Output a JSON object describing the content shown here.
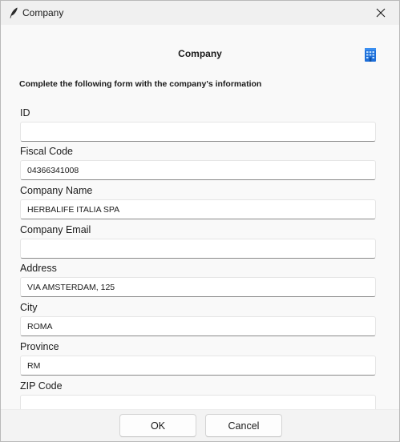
{
  "window": {
    "title": "Company",
    "icon": "feather-icon",
    "close_icon": "close-icon"
  },
  "header": {
    "title": "Company",
    "icon": "building-icon",
    "icon_color": "#1e6fd9"
  },
  "instruction": "Complete the following form with the company's information",
  "fields": [
    {
      "label": "ID",
      "value": "",
      "placeholder": ""
    },
    {
      "label": "Fiscal Code",
      "value": "04366341008",
      "placeholder": ""
    },
    {
      "label": "Company Name",
      "value": "HERBALIFE ITALIA SPA",
      "placeholder": ""
    },
    {
      "label": "Company Email",
      "value": "",
      "placeholder": ""
    },
    {
      "label": "Address",
      "value": "VIA AMSTERDAM, 125",
      "placeholder": ""
    },
    {
      "label": "City",
      "value": "ROMA",
      "placeholder": ""
    },
    {
      "label": "Province",
      "value": "RM",
      "placeholder": ""
    },
    {
      "label": "ZIP Code",
      "value": "",
      "placeholder": ""
    }
  ],
  "footer": {
    "ok_label": "OK",
    "cancel_label": "Cancel"
  }
}
